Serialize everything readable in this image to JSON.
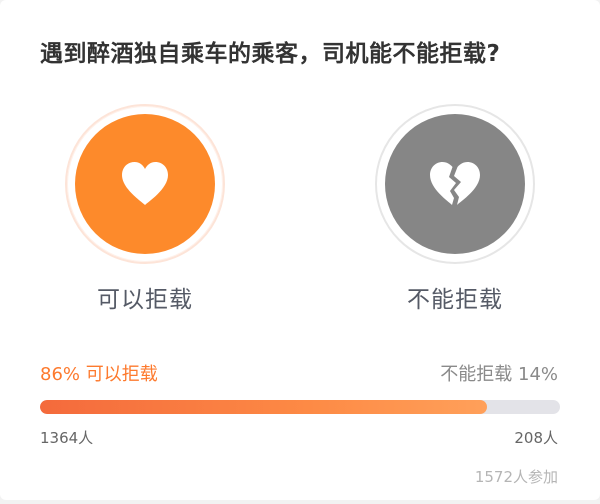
{
  "poll": {
    "question": "遇到醉酒独自乘车的乘客，司机能不能拒载?",
    "options": [
      {
        "label": "可以拒载",
        "icon": "heart-icon",
        "color": "#fd8a2b"
      },
      {
        "label": "不能拒载",
        "icon": "broken-heart-icon",
        "color": "#868686"
      }
    ]
  },
  "results": {
    "left_text": "86% 可以拒载",
    "right_text": "不能拒载 14%",
    "left_percent": 86,
    "left_count": "1364人",
    "right_count": "208人",
    "participants": "1572人参加",
    "accent_color": "#fd7a2e"
  }
}
